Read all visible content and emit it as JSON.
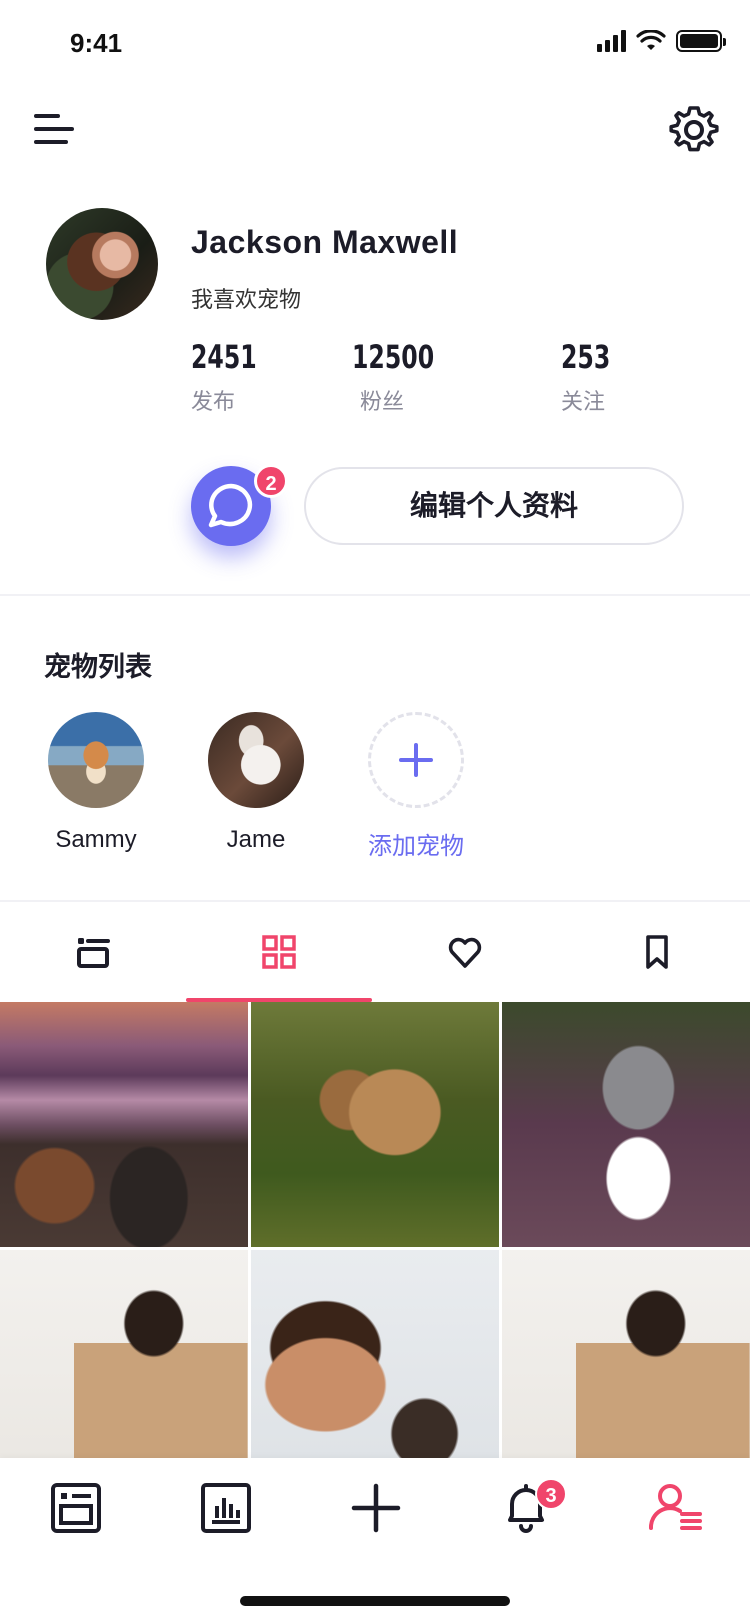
{
  "status_bar": {
    "time": "9:41"
  },
  "profile": {
    "name": "Jackson Maxwell",
    "bio": "我喜欢宠物",
    "stats": [
      {
        "value": "2451",
        "label": "发布"
      },
      {
        "value": "12500",
        "label": "粉丝"
      },
      {
        "value": "253",
        "label": "关注"
      }
    ],
    "message_badge": "2",
    "edit_button": "编辑个人资料"
  },
  "pets": {
    "title": "宠物列表",
    "items": [
      {
        "name": "Sammy"
      },
      {
        "name": "Jame"
      }
    ],
    "add_label": "添加宠物"
  },
  "tabs": {
    "items": [
      "list-icon",
      "grid-icon",
      "heart-icon",
      "bookmark-icon"
    ],
    "active": "grid-icon"
  },
  "bottom_nav": {
    "items": [
      "feed-icon",
      "stats-icon",
      "plus-icon",
      "bell-icon",
      "profile-icon"
    ],
    "active": "profile-icon",
    "notification_badge": "3"
  },
  "colors": {
    "accent": "#6a6cf0",
    "active": "#f0456b",
    "text": "#1c1c28",
    "muted": "#8a8a99"
  }
}
